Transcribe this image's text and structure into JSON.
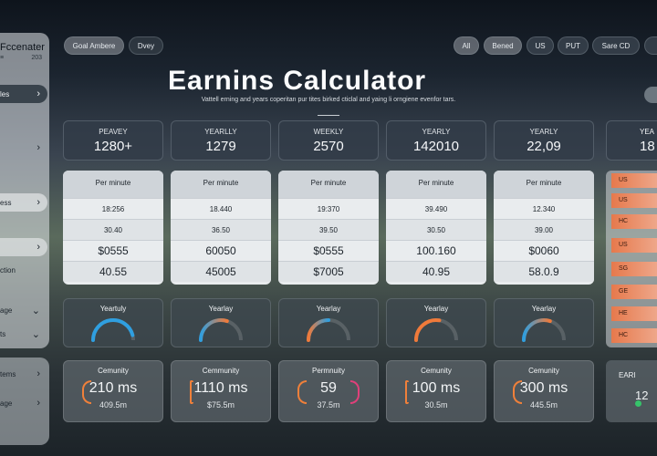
{
  "app": {
    "name": "Fccenater",
    "sub_left": "≡",
    "sub_right": "203"
  },
  "sidebar": {
    "items": [
      {
        "label": "les",
        "chevron": "›",
        "active": true
      },
      {
        "label": "",
        "chevron": "›",
        "active": false
      },
      {
        "label": "ess",
        "chevron": "›",
        "active": false
      },
      {
        "label": "",
        "chevron": "›",
        "active": false
      },
      {
        "label": "ction",
        "chevron": "",
        "active": false
      },
      {
        "label": "age",
        "chevron": "⌄",
        "active": false
      },
      {
        "label": "ts",
        "chevron": "⌄",
        "active": false
      }
    ],
    "bottom_items": [
      {
        "label": "tems",
        "chevron": "›"
      },
      {
        "label": "age",
        "chevron": "›"
      }
    ]
  },
  "top_left_pills": [
    "Goal Ambere",
    "Dvey"
  ],
  "top_right_pills": [
    "All",
    "Bened",
    "US",
    "PUT",
    "Sare CD"
  ],
  "header": {
    "title": "Earnins Calculator",
    "subtitle": "Vattell erning and years coperitan pur tites birked cticlal and yaing li orngiene evenfor tars."
  },
  "stats": [
    {
      "label": "PEAVEY",
      "value": "1280+"
    },
    {
      "label": "YEARLLY",
      "value": "1279"
    },
    {
      "label": "WEEKLY",
      "value": "2570"
    },
    {
      "label": "YEARLY",
      "value": "142010"
    },
    {
      "label": "YEARLY",
      "value": "22,09"
    },
    {
      "label": "YEA",
      "value": "18"
    }
  ],
  "rates": [
    {
      "header": "Per minute",
      "rows": [
        "18:256",
        "30.40",
        "$0555",
        "40.55"
      ]
    },
    {
      "header": "Per minute",
      "rows": [
        "18.440",
        "36.50",
        "60050",
        "45005"
      ]
    },
    {
      "header": "Per minute",
      "rows": [
        "19:370",
        "39.50",
        "$0555",
        "$7005"
      ]
    },
    {
      "header": "Per minute",
      "rows": [
        "39.490",
        "30.50",
        "100.160",
        "40.95"
      ]
    },
    {
      "header": "Per minute",
      "rows": [
        "12.340",
        "39.00",
        "$0060",
        "58.0.9"
      ]
    }
  ],
  "right_list": [
    "US",
    "US",
    "HC",
    "US",
    "SG",
    "GE",
    "HE",
    "HC"
  ],
  "gauges": [
    {
      "label": "Yeartuly",
      "value": 0.92,
      "colors": [
        "#2f9fe0",
        "#2f9fe0"
      ]
    },
    {
      "label": "Yearlay",
      "value": 0.6,
      "colors": [
        "#2f9fe0",
        "#f07a3a"
      ]
    },
    {
      "label": "Yearlay",
      "value": 0.5,
      "colors": [
        "#f07a3a",
        "#2f9fe0"
      ]
    },
    {
      "label": "Yearlay",
      "value": 0.55,
      "colors": [
        "#f07a3a",
        "#f07a3a"
      ]
    },
    {
      "label": "Yearlay",
      "value": 0.6,
      "colors": [
        "#2f9fe0",
        "#f07a3a"
      ]
    }
  ],
  "communities": [
    {
      "label": "Cemunity",
      "main": "210 ms",
      "sub": "409.5m"
    },
    {
      "label": "Cemmunity",
      "main": "1110 ms",
      "sub": "$75.5m"
    },
    {
      "label": "Permnuity",
      "main": "59",
      "sub": "37.5m"
    },
    {
      "label": "Cemunity",
      "main": "100 ms",
      "sub": "30.5m"
    },
    {
      "label": "Cemunity",
      "main": "300 ms",
      "sub": "445.5m"
    }
  ],
  "right_comm": {
    "label": "EARI",
    "value": "12"
  }
}
